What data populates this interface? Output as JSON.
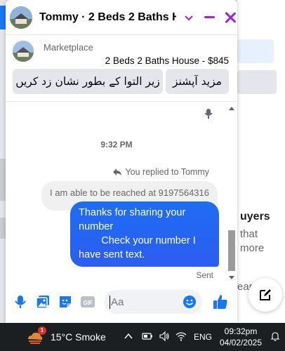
{
  "background": {
    "right_pane": {
      "heading_fragment": "uyers",
      "line1": "that",
      "line2": "more",
      "line3": "ear"
    }
  },
  "chat": {
    "header": {
      "title": "Tommy · 2 Beds 2 Baths House",
      "title_display": "Tommy · 2 Beds 2 Baths H..."
    },
    "listing": {
      "source": "Marketplace",
      "title": "2 Beds 2 Baths House - $845",
      "actions": [
        "زیر التوا کے بطور نشان زد کریں",
        "مزید آپشنز"
      ]
    },
    "messages": {
      "time_divider": "9:32 PM",
      "replied_note": "You replied to Tommy",
      "quoted_text": "I am able to be reached at 9197564316",
      "outgoing_lines": [
        "Thanks for sharing your",
        "number",
        "        Check your number I",
        "have sent text."
      ],
      "status": "Sent"
    },
    "composer": {
      "placeholder": "Aa"
    }
  },
  "taskbar": {
    "weather_badge": "1",
    "weather": "15°C  Smoke",
    "language": "ENG",
    "time": "09:32pm",
    "date": "04/02/2025"
  },
  "colors": {
    "accent_purple": "#a020e0",
    "messenger_blue": "#1e6df5",
    "taskbar_bg": "#1c1f22"
  }
}
